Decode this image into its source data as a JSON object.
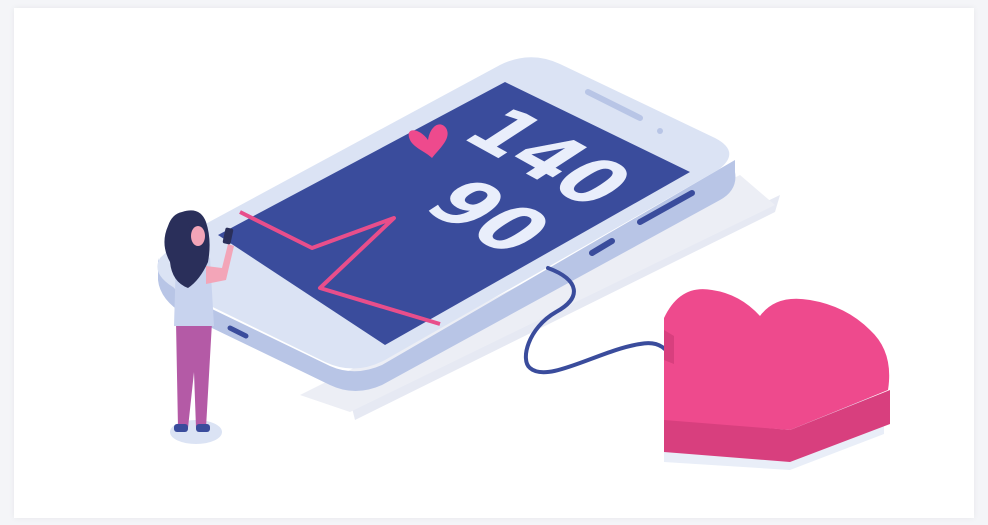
{
  "illustration": {
    "readings": {
      "systolic": "140",
      "diastolic": "90"
    },
    "colors": {
      "screen": "#3a4c9c",
      "screen_dark": "#2f3f86",
      "phone_body": "#dbe3f4",
      "phone_side": "#b8c5e6",
      "phone_shadow": "#e6e9f3",
      "heart_top": "#ee4a8d",
      "heart_side": "#d83f7e",
      "heart_base": "#e9eef8",
      "pulse_line": "#e84e8b",
      "cable": "#3a4c9c",
      "digits": "#e9eefb",
      "woman_hair": "#2a2f5a",
      "woman_pants": "#b45aa6",
      "woman_shirt": "#c8d3ee",
      "woman_skin": "#f3a5b8"
    },
    "icons": [
      "heart-icon",
      "pulse-line",
      "phone",
      "woman-figure",
      "heart-3d"
    ]
  }
}
